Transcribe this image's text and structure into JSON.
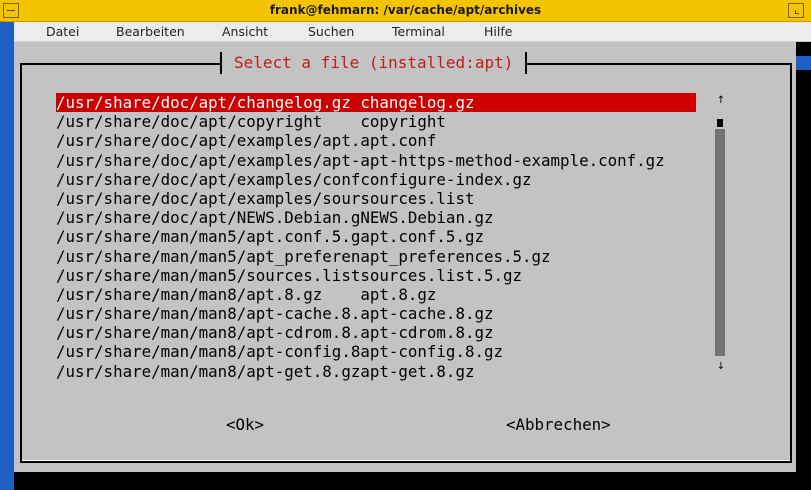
{
  "window": {
    "title": "frank@fehmarn: /var/cache/apt/archives"
  },
  "menubar": {
    "items": [
      "Datei",
      "Bearbeiten",
      "Ansicht",
      "Suchen",
      "Terminal",
      "Hilfe"
    ]
  },
  "dialog": {
    "title": "Select a file (installed:apt)",
    "selected_index": 0,
    "files": [
      "/usr/share/doc/apt/changelog.gz changelog.gz",
      "/usr/share/doc/apt/copyright    copyright",
      "/usr/share/doc/apt/examples/apt.apt.conf",
      "/usr/share/doc/apt/examples/apt-apt-https-method-example.conf.gz",
      "/usr/share/doc/apt/examples/confconfigure-index.gz",
      "/usr/share/doc/apt/examples/soursources.list",
      "/usr/share/doc/apt/NEWS.Debian.gNEWS.Debian.gz",
      "/usr/share/man/man5/apt.conf.5.gapt.conf.5.gz",
      "/usr/share/man/man5/apt_preferenapt_preferences.5.gz",
      "/usr/share/man/man5/sources.listsources.list.5.gz",
      "/usr/share/man/man8/apt.8.gz    apt.8.gz",
      "/usr/share/man/man8/apt-cache.8.apt-cache.8.gz",
      "/usr/share/man/man8/apt-cdrom.8.apt-cdrom.8.gz",
      "/usr/share/man/man8/apt-config.8apt-config.8.gz",
      "/usr/share/man/man8/apt-get.8.gzapt-get.8.gz"
    ],
    "scroll_up": "↑",
    "scroll_down": "↓",
    "ok_label": "<Ok>",
    "cancel_label": "<Abbrechen>"
  },
  "colors": {
    "titlebar": "#f5c400",
    "terminal_bg": "#c3c3c3",
    "selection": "#cc0000",
    "dialog_title": "#c41a1a"
  }
}
